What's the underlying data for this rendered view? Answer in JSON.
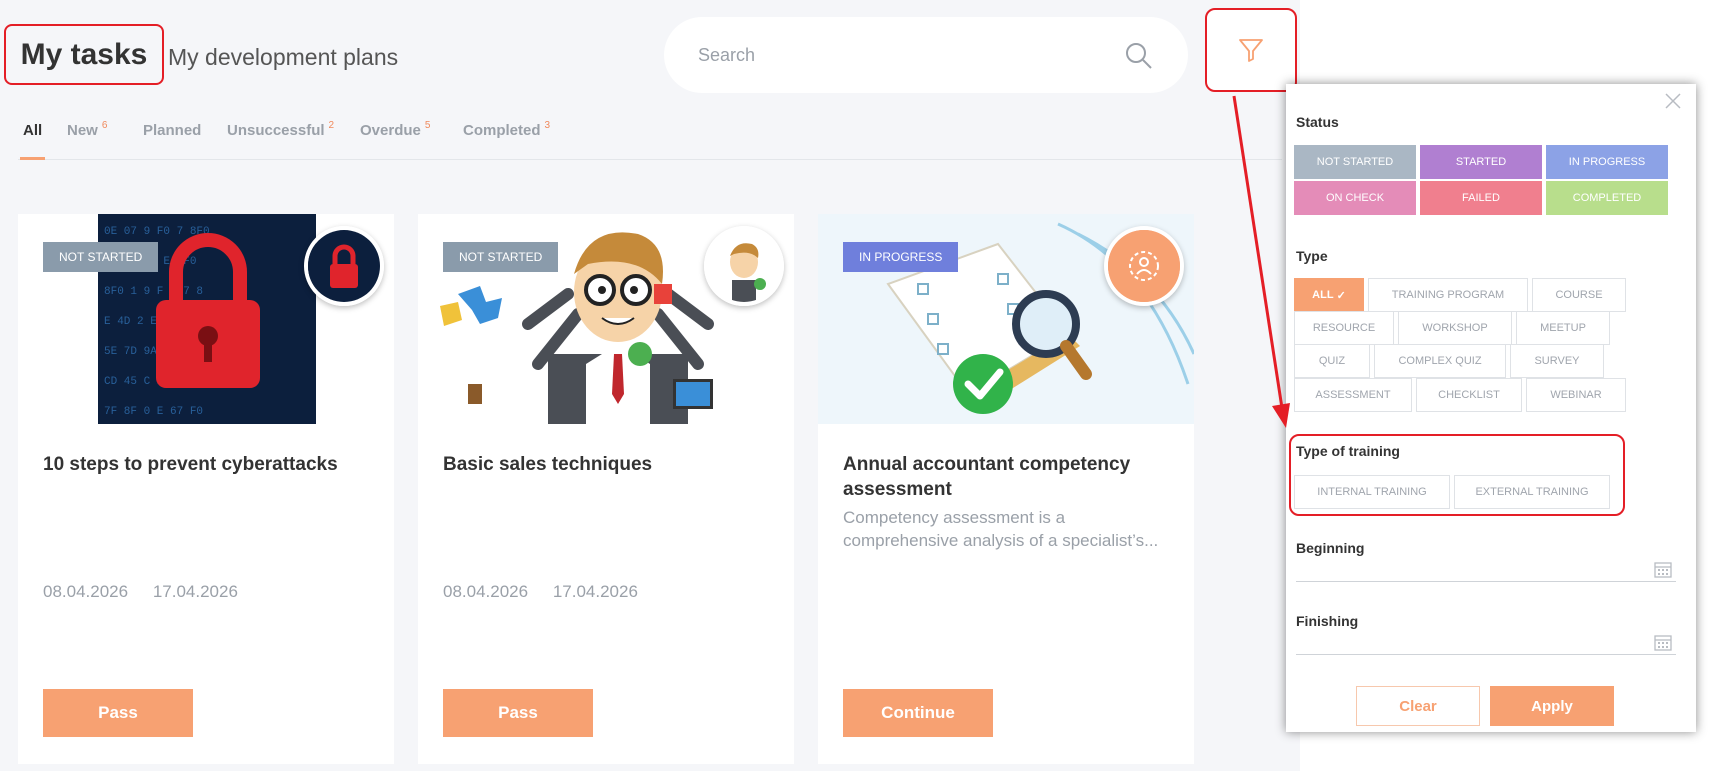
{
  "header": {
    "title": "My tasks",
    "subtitle": "My development plans"
  },
  "search": {
    "placeholder": "Search",
    "icon": "search-icon"
  },
  "filter_button": {
    "icon": "funnel-icon"
  },
  "tabs": [
    {
      "label": "All",
      "count": "",
      "active": true
    },
    {
      "label": "New",
      "count": "6"
    },
    {
      "label": "Planned",
      "count": ""
    },
    {
      "label": "Unsuccessful",
      "count": "2"
    },
    {
      "label": "Overdue",
      "count": "5"
    },
    {
      "label": "Completed",
      "count": "3"
    }
  ],
  "cards": [
    {
      "status": "NOT STARTED",
      "status_color": "#8a9bab",
      "title": "10 steps to prevent cyberattacks",
      "description": "",
      "start": "08.04.2026",
      "end": "17.04.2026",
      "button": "Pass"
    },
    {
      "status": "NOT STARTED",
      "status_color": "#8a9bab",
      "title": "Basic sales techniques",
      "description": "",
      "start": "08.04.2026",
      "end": "17.04.2026",
      "button": "Pass"
    },
    {
      "status": "IN PROGRESS",
      "status_color": "#6f7fdc",
      "title": "Annual accountant competency assessment",
      "description": "Competency assessment is a comprehensive analysis of a specialist’s...",
      "start": "",
      "end": "",
      "button": "Continue"
    }
  ],
  "filter_panel": {
    "status_label": "Status",
    "statuses": [
      {
        "label": "NOT STARTED",
        "color": "#aab7c4"
      },
      {
        "label": "STARTED",
        "color": "#b07fd1"
      },
      {
        "label": "IN PROGRESS",
        "color": "#8ca2e6"
      },
      {
        "label": "ON CHECK",
        "color": "#e48cb8"
      },
      {
        "label": "FAILED",
        "color": "#f07f8e"
      },
      {
        "label": "COMPLETED",
        "color": "#b8de8c"
      }
    ],
    "type_label": "Type",
    "types": [
      "ALL",
      "TRAINING PROGRAM",
      "COURSE",
      "RESOURCE",
      "WORKSHOP",
      "MEETUP",
      "QUIZ",
      "COMPLEX QUIZ",
      "SURVEY",
      "ASSESSMENT",
      "CHECKLIST",
      "WEBINAR"
    ],
    "type_of_training_label": "Type of training",
    "training_types": [
      "INTERNAL TRAINING",
      "EXTERNAL TRAINING"
    ],
    "beginning_label": "Beginning",
    "finishing_label": "Finishing",
    "clear_label": "Clear",
    "apply_label": "Apply"
  },
  "colors": {
    "accent": "#f7a172",
    "highlight": "#e41e26"
  }
}
